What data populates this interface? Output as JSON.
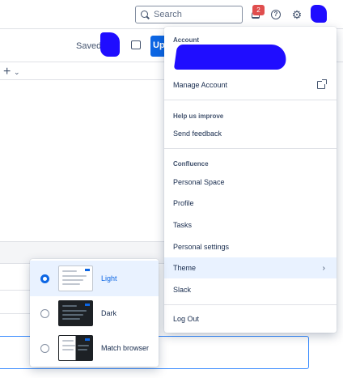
{
  "topbar": {
    "search_placeholder": "Search",
    "notification_count": "2",
    "help_glyph": "?",
    "gear_glyph": "⚙",
    "icons": [
      "search-icon",
      "bell-icon",
      "help-icon",
      "gear-icon",
      "avatar"
    ]
  },
  "editor": {
    "saved_label": "Saved",
    "update_button_label": "Up",
    "plus_glyph": "+",
    "chevron_glyph": "⌄"
  },
  "account_menu": {
    "account_section_title": "Account",
    "manage_account_label": "Manage Account",
    "help_section_title": "Help us improve",
    "send_feedback_label": "Send feedback",
    "confluence_section_title": "Confluence",
    "items": [
      {
        "label": "Personal Space"
      },
      {
        "label": "Profile"
      },
      {
        "label": "Tasks"
      },
      {
        "label": "Personal settings"
      },
      {
        "label": "Theme"
      },
      {
        "label": "Slack"
      }
    ],
    "log_out_label": "Log Out",
    "chevron_glyph": "›"
  },
  "theme_menu": {
    "options": [
      {
        "label": "Light",
        "selected": true
      },
      {
        "label": "Dark",
        "selected": false
      },
      {
        "label": "Match browser",
        "selected": false
      }
    ]
  },
  "colors": {
    "accent": "#0c66e4",
    "selected_bg": "#e9f2ff",
    "highlight": "#ebf02d",
    "redaction": "#1f0dff",
    "badge": "#e04e4e"
  }
}
